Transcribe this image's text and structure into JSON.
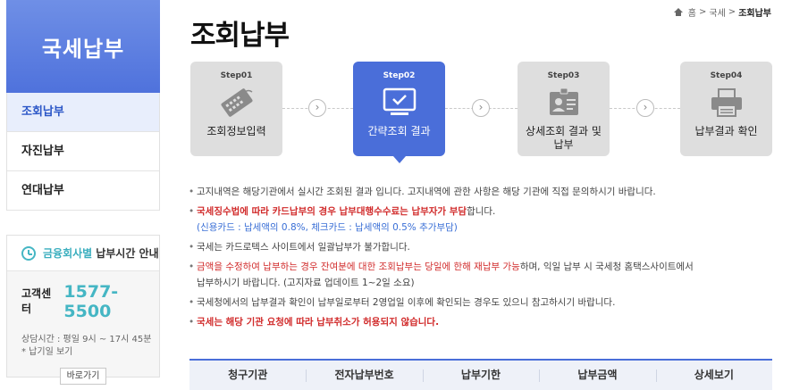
{
  "sidebar": {
    "title": "국세납부",
    "menu": [
      "조회납부",
      "자진납부",
      "연대납부"
    ],
    "time_box": {
      "highlight": "금융회사별",
      "label": "납부시간 안내",
      "call_center_label": "고객센터",
      "call_center_number": "1577-5500",
      "info_line1": "상담시간 : 평일 9시 ~ 17시 45분",
      "info_line2": "* 납기일 보기",
      "button": "바로가기"
    }
  },
  "breadcrumb": {
    "home": "홈",
    "sep": ">",
    "level1": "국세",
    "current": "조회납부"
  },
  "page_title": "조회납부",
  "steps": [
    {
      "num": "Step01",
      "label": "조회정보입력",
      "icon": "card-icon"
    },
    {
      "num": "Step02",
      "label": "간략조회 결과",
      "icon": "monitor-check-icon"
    },
    {
      "num": "Step03",
      "label": "상세조회 결과 및 납부",
      "icon": "id-card-icon"
    },
    {
      "num": "Step04",
      "label": "납부결과 확인",
      "icon": "printer-icon"
    }
  ],
  "notes": {
    "n1": "고지내역은 해당기관에서 실시간 조회된 결과 입니다. 고지내역에 관한 사항은 해당 기관에 직접 문의하시기 바랍니다.",
    "n2_red": "국세징수법에 따라 카드납부의 경우 납부대행수수료는 납부자가 부담",
    "n2_rest": "합니다.",
    "n2_blue": "(신용카드 : 납세액의 0.8%, 체크카드 : 납세액의 0.5% 추가부담)",
    "n3": "국세는 카드로텍스 사이트에서 일괄납부가 불가합니다.",
    "n4_red": "금액을 수정하여 납부하는 경우 잔여분에 대한 조회납부는 당일에 한해 재납부 가능",
    "n4_rest": "하며, 익일 납부 시 국세청 홈택스사이트에서",
    "n4_line2": "납부하시기 바랍니다. (고지자료 업데이트 1~2일 소요)",
    "n5": "국세청에서의 납부결과 확인이 납부일로부터 2영업일 이후에 확인되는 경우도 있으니 참고하시기 바랍니다.",
    "n6": "국세는 해당 기관 요청에 따라 납부취소가 허용되지 않습니다."
  },
  "table": {
    "headers": [
      "청구기관",
      "전자납부번호",
      "납부기한",
      "납부금액",
      "상세보기"
    ]
  },
  "colors": {
    "accent": "#4a6ed9",
    "teal": "#45b6c4",
    "warning": "#d12b2b"
  }
}
